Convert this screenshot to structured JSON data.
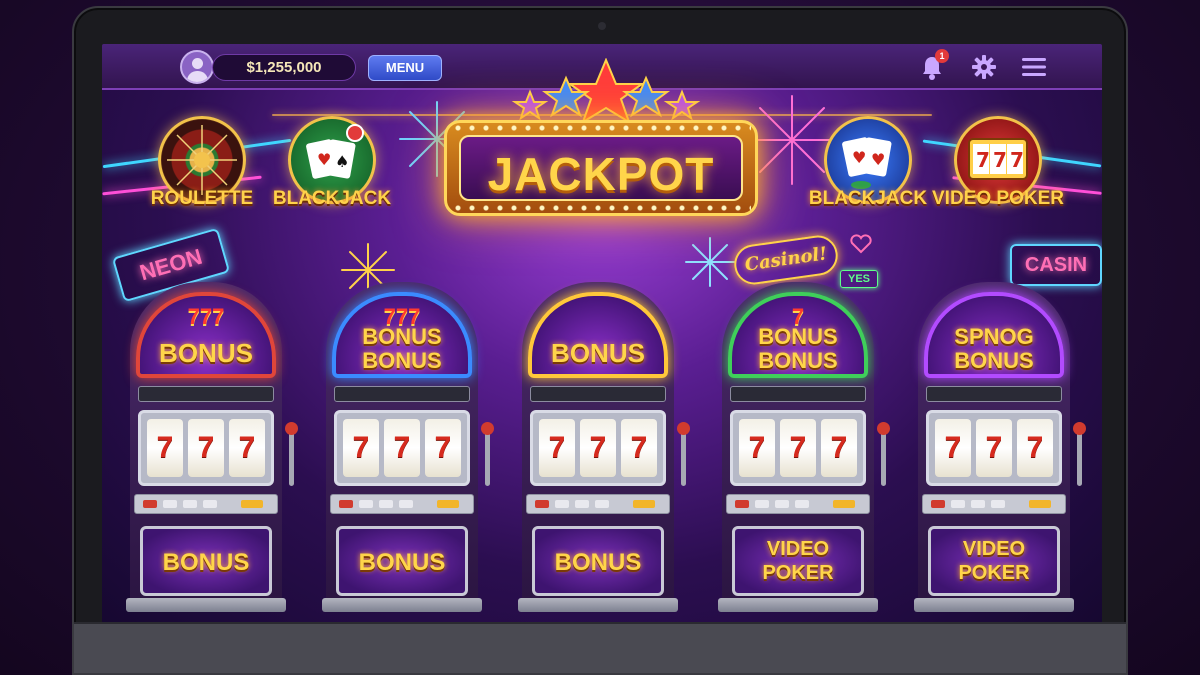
{
  "topbar": {
    "balance": "$1,255,000",
    "menu_label": "MENU",
    "notification_count": "1"
  },
  "jackpot": {
    "title": "JACKPOT"
  },
  "games": [
    {
      "label": "ROULETTE"
    },
    {
      "label": "BLACKJACK"
    },
    {
      "label": "BLACKJACK"
    },
    {
      "label": "VIDEO POKER"
    }
  ],
  "signs": {
    "neon": "NEON",
    "casino_script": "Casinol!",
    "yes": "YES",
    "casin": "CASIN"
  },
  "slots": [
    {
      "topper_num": "777",
      "topper": "BONUS",
      "topper2": "",
      "reels": [
        "7",
        "7",
        "7"
      ],
      "lower": "BONUS",
      "lower2": "",
      "accent": "#e0463a"
    },
    {
      "topper_num": "777",
      "topper": "BONUS",
      "topper2": "BONUS",
      "reels": [
        "7",
        "7",
        "7"
      ],
      "lower": "BONUS",
      "lower2": "",
      "accent": "#3b8bff"
    },
    {
      "topper_num": "",
      "topper": "BONUS",
      "topper2": "",
      "reels": [
        "7",
        "7",
        "7"
      ],
      "lower": "BONUS",
      "lower2": "",
      "accent": "#ffc83a"
    },
    {
      "topper_num": "7",
      "topper": "BONUS",
      "topper2": "BONUS",
      "reels": [
        "7",
        "7",
        "7"
      ],
      "lower": "VIDEO",
      "lower2": "POKER",
      "accent": "#3fcf5a"
    },
    {
      "topper_num": "",
      "topper": "SPNOG",
      "topper2": "BONUS",
      "reels": [
        "7",
        "7",
        "7"
      ],
      "lower": "VIDEO",
      "lower2": "POKER",
      "accent": "#b24bff"
    }
  ]
}
